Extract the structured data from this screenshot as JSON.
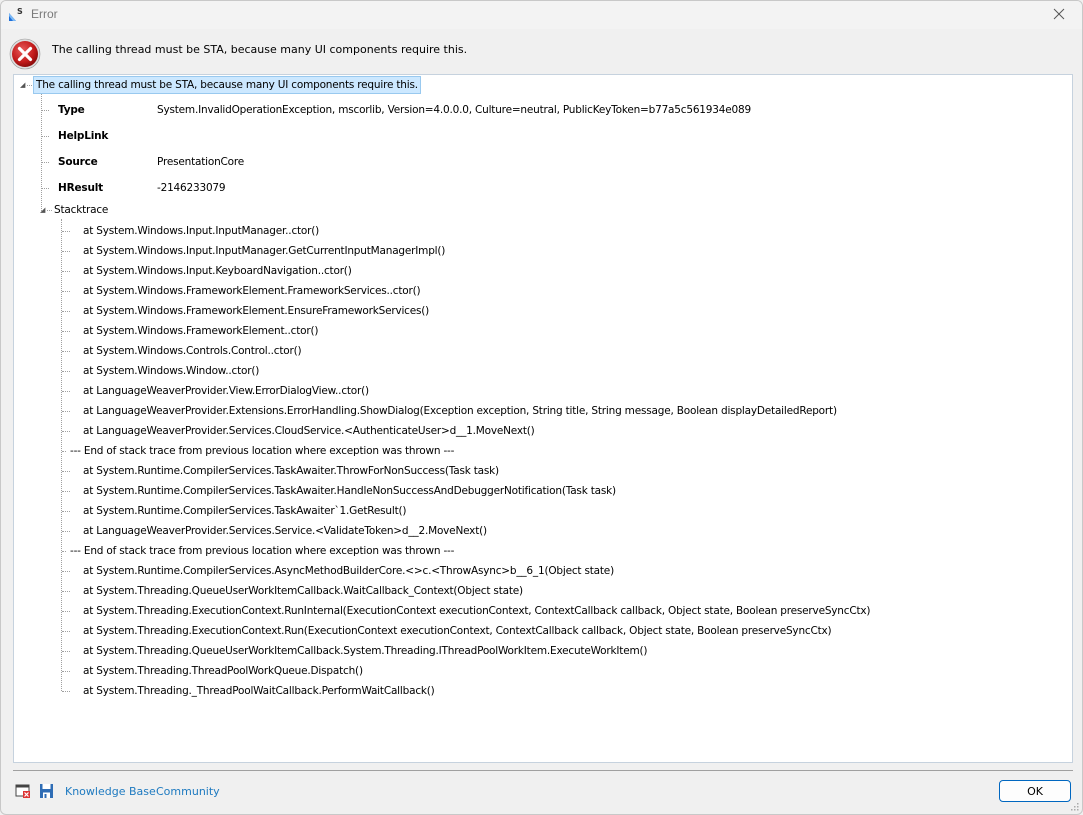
{
  "window": {
    "title": "Error",
    "app_icon": "s-app-logo-icon",
    "close_icon": "close-icon"
  },
  "header": {
    "icon": "error-icon",
    "message": "The calling thread must be STA, because many UI components require this."
  },
  "tree": {
    "root_label": "The calling thread must be STA, because many UI components require this.",
    "properties": [
      {
        "key": "Type",
        "value": "System.InvalidOperationException, mscorlib, Version=4.0.0.0, Culture=neutral, PublicKeyToken=b77a5c561934e089"
      },
      {
        "key": "HelpLink",
        "value": ""
      },
      {
        "key": "Source",
        "value": "PresentationCore"
      },
      {
        "key": "HResult",
        "value": "-2146233079"
      }
    ],
    "stacktrace_label": "Stacktrace",
    "stacktrace": [
      {
        "text": "at System.Windows.Input.InputManager..ctor()",
        "separator": false
      },
      {
        "text": "at System.Windows.Input.InputManager.GetCurrentInputManagerImpl()",
        "separator": false
      },
      {
        "text": "at System.Windows.Input.KeyboardNavigation..ctor()",
        "separator": false
      },
      {
        "text": "at System.Windows.FrameworkElement.FrameworkServices..ctor()",
        "separator": false
      },
      {
        "text": "at System.Windows.FrameworkElement.EnsureFrameworkServices()",
        "separator": false
      },
      {
        "text": "at System.Windows.FrameworkElement..ctor()",
        "separator": false
      },
      {
        "text": "at System.Windows.Controls.Control..ctor()",
        "separator": false
      },
      {
        "text": "at System.Windows.Window..ctor()",
        "separator": false
      },
      {
        "text": "at LanguageWeaverProvider.View.ErrorDialogView..ctor()",
        "separator": false
      },
      {
        "text": "at LanguageWeaverProvider.Extensions.ErrorHandling.ShowDialog(Exception exception, String title, String message, Boolean displayDetailedReport)",
        "separator": false
      },
      {
        "text": "at LanguageWeaverProvider.Services.CloudService.<AuthenticateUser>d__1.MoveNext()",
        "separator": false
      },
      {
        "text": "--- End of stack trace from previous location where exception was thrown ---",
        "separator": true
      },
      {
        "text": "at System.Runtime.CompilerServices.TaskAwaiter.ThrowForNonSuccess(Task task)",
        "separator": false
      },
      {
        "text": "at System.Runtime.CompilerServices.TaskAwaiter.HandleNonSuccessAndDebuggerNotification(Task task)",
        "separator": false
      },
      {
        "text": "at System.Runtime.CompilerServices.TaskAwaiter`1.GetResult()",
        "separator": false
      },
      {
        "text": "at LanguageWeaverProvider.Services.Service.<ValidateToken>d__2.MoveNext()",
        "separator": false
      },
      {
        "text": "--- End of stack trace from previous location where exception was thrown ---",
        "separator": true
      },
      {
        "text": "at System.Runtime.CompilerServices.AsyncMethodBuilderCore.<>c.<ThrowAsync>b__6_1(Object state)",
        "separator": false
      },
      {
        "text": "at System.Threading.QueueUserWorkItemCallback.WaitCallback_Context(Object state)",
        "separator": false
      },
      {
        "text": "at System.Threading.ExecutionContext.RunInternal(ExecutionContext executionContext, ContextCallback callback, Object state, Boolean preserveSyncCtx)",
        "separator": false
      },
      {
        "text": "at System.Threading.ExecutionContext.Run(ExecutionContext executionContext, ContextCallback callback, Object state, Boolean preserveSyncCtx)",
        "separator": false
      },
      {
        "text": "at System.Threading.QueueUserWorkItemCallback.System.Threading.IThreadPoolWorkItem.ExecuteWorkItem()",
        "separator": false
      },
      {
        "text": "at System.Threading.ThreadPoolWorkQueue.Dispatch()",
        "separator": false
      },
      {
        "text": "at System.Threading._ThreadPoolWaitCallback.PerformWaitCallback()",
        "separator": false
      }
    ]
  },
  "footer": {
    "icons": [
      "close-window-icon",
      "save-icon"
    ],
    "links": [
      "Knowledge Base",
      "Community"
    ],
    "ok_label": "OK",
    "link_color": "#1e7ac0"
  }
}
